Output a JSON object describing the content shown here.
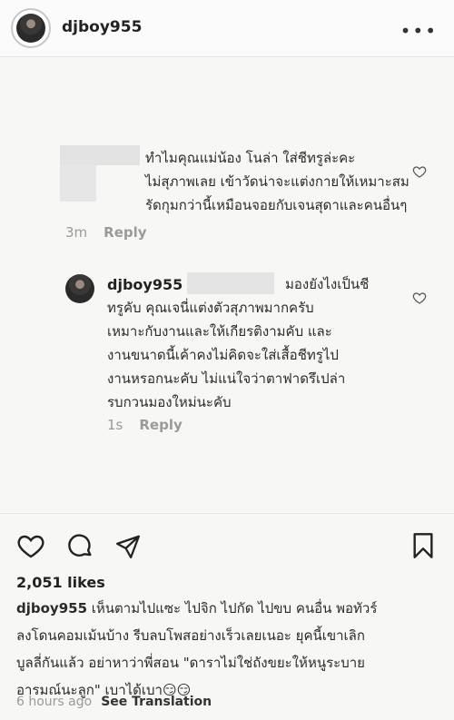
{
  "post": {
    "username": "djboy955",
    "more_label": "•••"
  },
  "comments": [
    {
      "text": "ทำไมคุณแม่น้อง โนล่า ใส่ชีทรูล่ะคะ\nไม่สุภาพเลย เข้าวัดน่าจะแต่งกายให้เหมาะสม\nรัดกุมกว่านี้เหมือนจอยกับเจนสุดาและคนอื่นๆ",
      "time": "3m",
      "reply_label": "Reply"
    }
  ],
  "reply": {
    "username": "djboy955",
    "text_line1": "มองยังไงเป็นชี",
    "text_rest": "ทรูคับ คุณเจนี่แต่งตัวสุภาพมากครับ\nเหมาะกับงานและให้เกียรติงามคับ และ\nงานขนาดนี้เค้าคงไม่คิดจะใส่เสื้อชีทรูไป\nงานหรอกนะคับ ไม่แน่ใจว่าตาฟาดรึเปล่า\nรบกวนมองใหม่นะคับ",
    "time": "1s",
    "reply_label": "Reply"
  },
  "stats": {
    "likes": "2,051 likes"
  },
  "caption": {
    "username": "djboy955",
    "first_line": " เห็นตามไปแซะ ไปจิก ไปกัด ไปขบ คนอื่น พอทัวร์",
    "rest": "ลงโดนคอมเม้นบ้าง รีบลบโพสอย่างเร็วเลยเนอะ ยุคนี้เขาเลิก\nบูลลี่กันแล้ว อย่าหาว่าพี่สอน \"ดาราไม่ใช่ถังขยะให้หนูระบาย\nอารมณ์นะลูก\" เบาได้เบา😏😏"
  },
  "footer": {
    "time": "6 hours ago",
    "translation": "See Translation"
  }
}
